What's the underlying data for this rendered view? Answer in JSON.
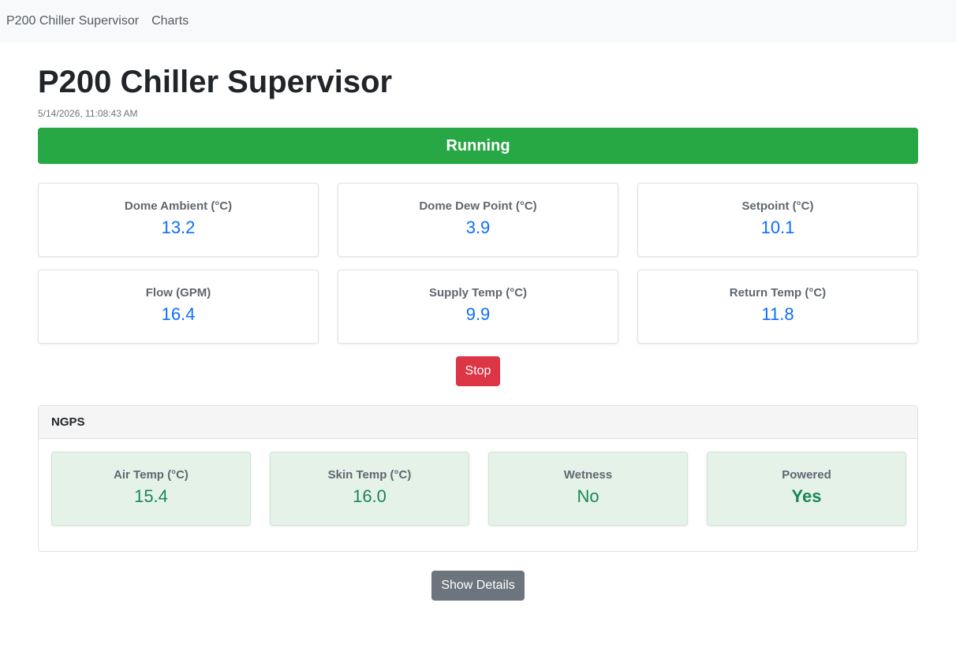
{
  "nav": {
    "brand": "P200 Chiller Supervisor",
    "links": [
      "Charts"
    ]
  },
  "page": {
    "title": "P200 Chiller Supervisor",
    "timestamp": "5/14/2026, 11:08:43 AM"
  },
  "status": {
    "label": "Running",
    "color": "#28a745"
  },
  "metrics": [
    {
      "label": "Dome Ambient (°C)",
      "value": "13.2"
    },
    {
      "label": "Dome Dew Point (°C)",
      "value": "3.9"
    },
    {
      "label": "Setpoint (°C)",
      "value": "10.1"
    },
    {
      "label": "Flow (GPM)",
      "value": "16.4"
    },
    {
      "label": "Supply Temp (°C)",
      "value": "9.9"
    },
    {
      "label": "Return Temp (°C)",
      "value": "11.8"
    }
  ],
  "controls": {
    "stop_label": "Stop",
    "details_label": "Show Details"
  },
  "ngps": {
    "title": "NGPS",
    "items": [
      {
        "label": "Air Temp (°C)",
        "value": "15.4"
      },
      {
        "label": "Skin Temp (°C)",
        "value": "16.0"
      },
      {
        "label": "Wetness",
        "value": "No"
      },
      {
        "label": "Powered",
        "value": "Yes"
      }
    ]
  },
  "colors": {
    "accent": "#0d6efd",
    "ok": "#198754",
    "danger": "#dc3545",
    "secondary": "#6c757d"
  }
}
